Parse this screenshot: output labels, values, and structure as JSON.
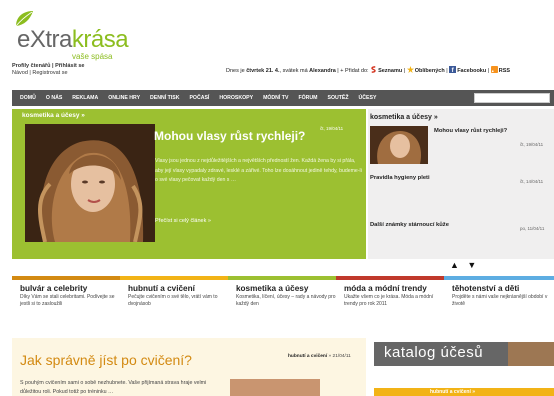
{
  "logo": {
    "prefix": "e",
    "brand": "Xtra",
    "suffix": "krása",
    "tagline": "vaše spása"
  },
  "profile": {
    "line1": "Profily čtenářů | Přihlásit se",
    "line2": "Návod | Registrovat se"
  },
  "datebar": {
    "text_pre": "Dnes je ",
    "date": "čtvrtek 21. 4.",
    "text_mid": ", svátek má ",
    "name": "Alexandra",
    "text_add": " | + Přidat do: ",
    "links": [
      "Seznamu",
      "Oblíbených",
      "Facebooku",
      "RSS"
    ]
  },
  "nav": {
    "items": [
      "DOMŮ",
      "O NÁS",
      "REKLAMA",
      "ONLINE HRY",
      "DENNÍ TISK",
      "POČASÍ",
      "HOROSKOPY",
      "MÓDNÍ TV",
      "FÓRUM",
      "SOUTĚŽ",
      "ÚČESY"
    ],
    "search_placeholder": ""
  },
  "feature": {
    "category": "kosmetika a účesy »",
    "title": "Mohou vlasy růst rychleji?",
    "date": "čt, 19/04/11",
    "excerpt": "Vlasy jsou jednou z nejdůležitějších a největších předností žen. Každá žena by si přála, aby její vlasy vypadaly zdravé, lesklé a zářivé. Toho lze dosáhnout jedině tehdy, budeme-li o své vlasy pečovat každý den s …",
    "more": "Přečíst si celý článek »"
  },
  "side": {
    "category": "kosmetika a účesy »",
    "items": [
      {
        "title": "Mohou vlasy růst rychleji?",
        "date": "čt, 19/04/11"
      },
      {
        "title": "Pravidla hygieny pleti",
        "date": "čt, 14/04/11"
      },
      {
        "title": "Další známky stárnoucí kůže",
        "date": "po, 11/04/11"
      }
    ],
    "arrows": "▲ ▼"
  },
  "categories": [
    {
      "title": "bulvár a celebrity",
      "desc": "Díky Vám se stali celebritami. Podívejte se jestli si to zasloužili",
      "color": "#d38a12"
    },
    {
      "title": "hubnutí a cvičení",
      "desc": "Pečujte cvičením o své tělo, vrátí vám to dvojnásob",
      "color": "#f2b316"
    },
    {
      "title": "kosmetika a účesy",
      "desc": "Kosmetika, líčení, účesy – rady a návody pro každý den",
      "color": "#9cc031"
    },
    {
      "title": "móda a módní trendy",
      "desc": "Ukažte všem co je krása. Móda a módní trendy pro rok 2011",
      "color": "#c0392b"
    },
    {
      "title": "těhotenství a děti",
      "desc": "Projděte s námi vaše nejkrásnější období v životě",
      "color": "#5dade2"
    }
  ],
  "article": {
    "title": "Jak správně jíst po cvičení?",
    "category": "hubnutí a cvičení",
    "date": " » 21/04/11",
    "lead": "S pouhým cvičením sami o sobě nezhubnete. Vaše přijímaná strava hraje velmi důležitou roli. Pokud totiž po tréninku …"
  },
  "catalog": {
    "label": "katalog účesů"
  },
  "yellowbar": {
    "label": "hubnutí a cvičení »"
  }
}
